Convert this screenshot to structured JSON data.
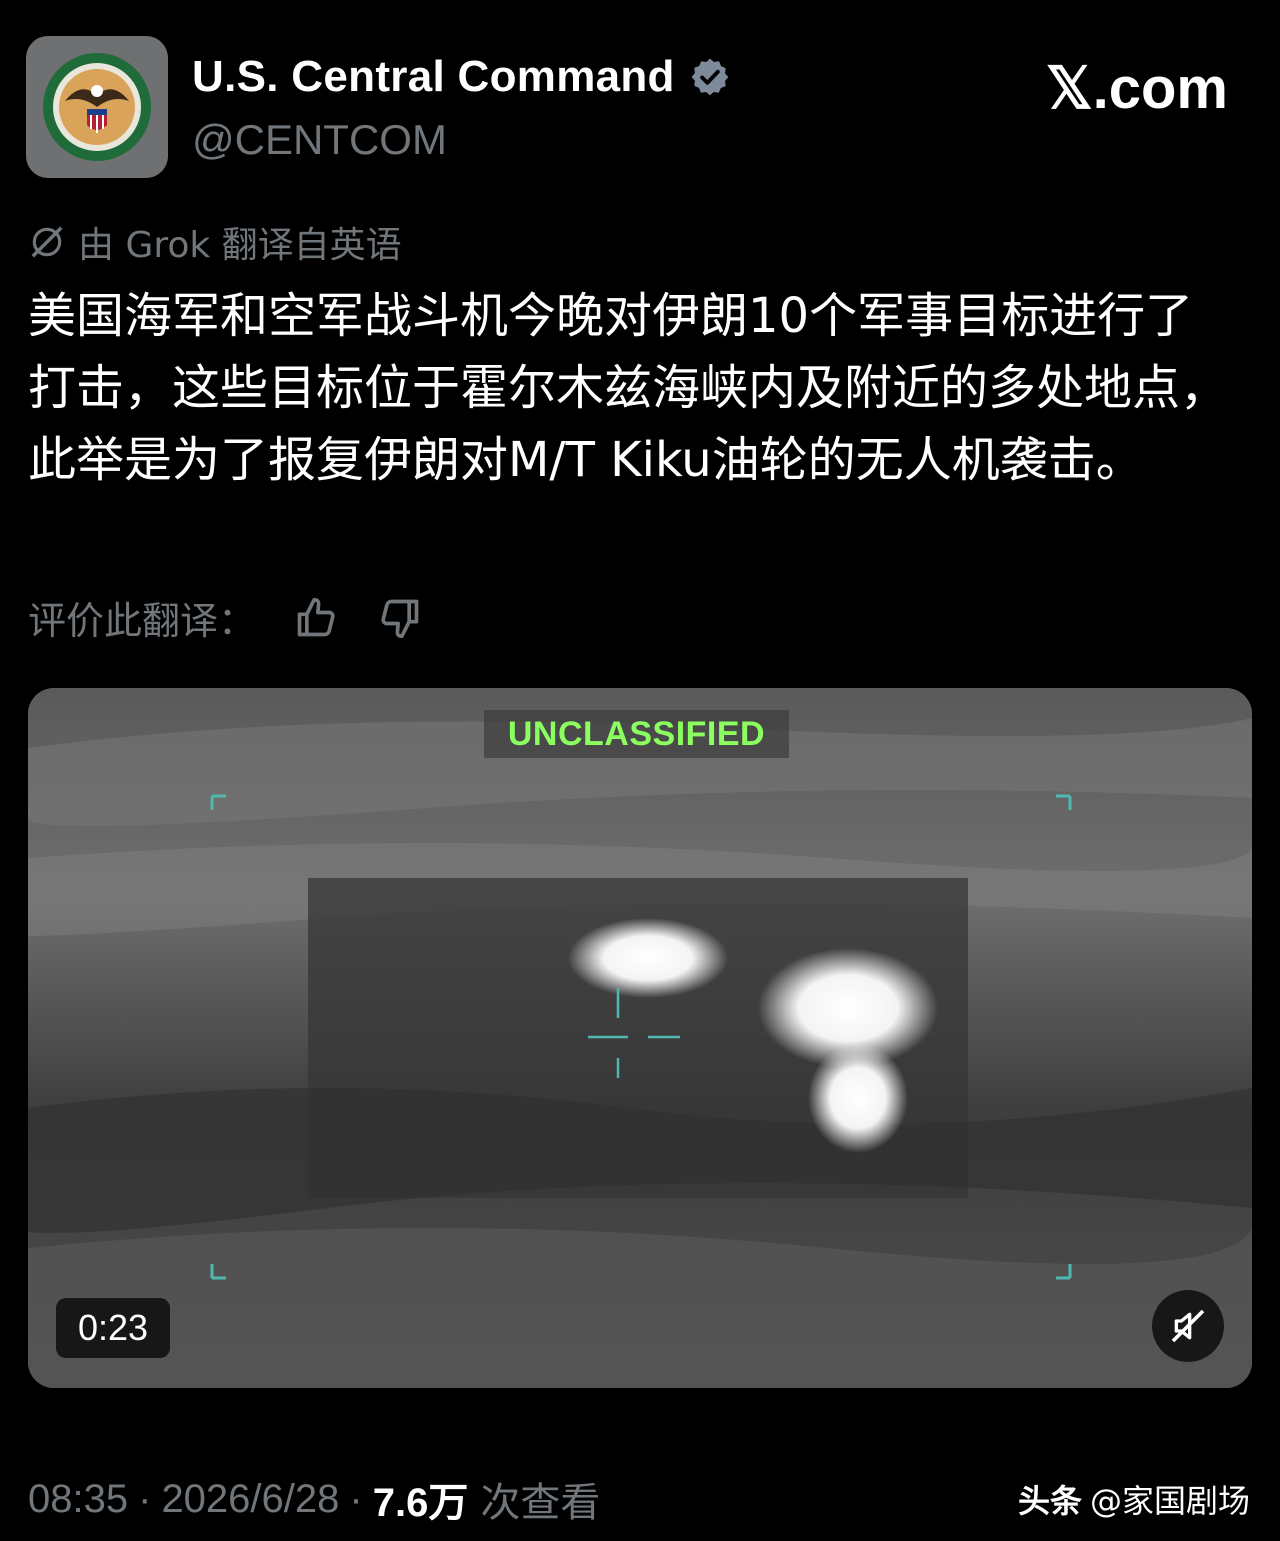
{
  "author": {
    "name": "U.S. Central Command",
    "handle": "@CENTCOM",
    "avatar_icon": "centcom-seal-icon",
    "verified_icon": "verified-badge-icon"
  },
  "site": {
    "label": "𝕏.com"
  },
  "translation": {
    "label": "由 Grok 翻译自英语",
    "text": "美国海军和空军战斗机今晚对伊朗10个军事目标进行了打击，这些目标位于霍尔木兹海峡内及附近的多处地点，此举是为了报复伊朗对M/T Kiku油轮的无人机袭击。",
    "rate_label": "评价此翻译：",
    "like_icon": "thumbs-up-icon",
    "dislike_icon": "thumbs-down-icon"
  },
  "video": {
    "overlay_label": "UNCLASSIFIED",
    "duration": "0:23",
    "mute_icon": "speaker-muted-icon",
    "accent_color": "#8cff60"
  },
  "meta": {
    "time": "08:35",
    "date": "2026/6/28",
    "views": "7.6万",
    "views_label": "次查看"
  },
  "watermark": {
    "brand": "头条",
    "account": "@家国剧场"
  }
}
